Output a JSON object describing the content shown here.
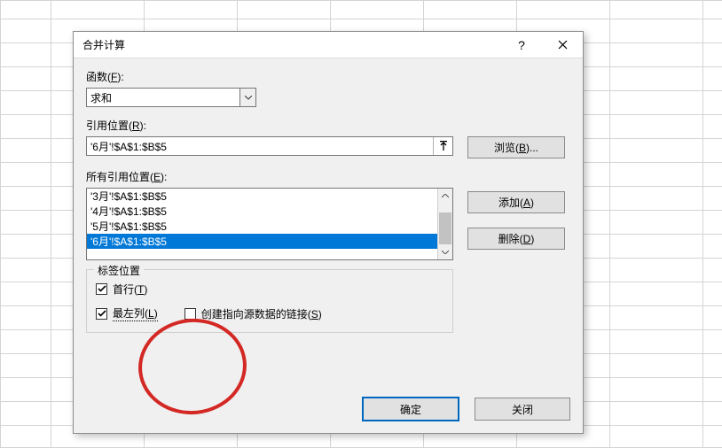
{
  "dialog": {
    "title": "合并计算"
  },
  "function": {
    "label_pre": "函数(",
    "label_u": "F",
    "label_post": "):",
    "value": "求和"
  },
  "reference": {
    "label_pre": "引用位置(",
    "label_u": "R",
    "label_post": "):",
    "value": "'6月'!$A$1:$B$5",
    "browse_pre": "浏览(",
    "browse_u": "B",
    "browse_post": ")..."
  },
  "allrefs": {
    "label_pre": "所有引用位置(",
    "label_u": "E",
    "label_post": "):",
    "items": [
      "'3月'!$A$1:$B$5",
      "'4月'!$A$1:$B$5",
      "'5月'!$A$1:$B$5",
      "'6月'!$A$1:$B$5"
    ],
    "selected_index": 3,
    "add_pre": "添加(",
    "add_u": "A",
    "add_post": ")",
    "delete_pre": "删除(",
    "delete_u": "D",
    "delete_post": ")"
  },
  "labelpos": {
    "legend": "标签位置",
    "toprow_pre": "首行(",
    "toprow_u": "T",
    "toprow_post": ")",
    "toprow_checked": true,
    "leftcol_pre": "最左列(",
    "leftcol_u": "L",
    "leftcol_post": ")",
    "leftcol_checked": true,
    "link_pre": "创建指向源数据的链接(",
    "link_u": "S",
    "link_post": ")",
    "link_checked": false
  },
  "footer": {
    "ok": "确定",
    "close": "关闭"
  }
}
